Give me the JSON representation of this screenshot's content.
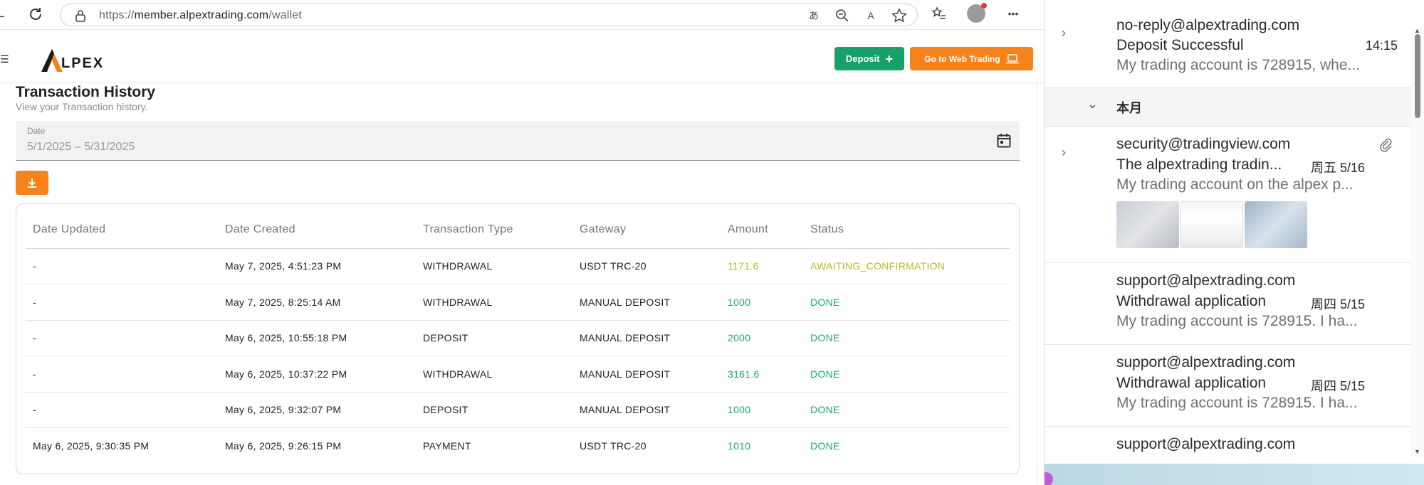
{
  "browser": {
    "url_prefix": "https://",
    "url_host": "member.alpextrading.com",
    "url_path": "/wallet"
  },
  "header": {
    "logo_text": "LPEX",
    "deposit_label": "Deposit",
    "web_trading_label": "Go to Web Trading",
    "accent_green": "#18a06a",
    "accent_orange": "#f7821b"
  },
  "main": {
    "title": "Transaction History",
    "subtitle": "View your Transaction history.",
    "date_label": "Date",
    "date_value": "5/1/2025 – 5/31/2025"
  },
  "table": {
    "columns": [
      "Date Updated",
      "Date Created",
      "Transaction Type",
      "Gateway",
      "Amount",
      "Status"
    ],
    "rows": [
      {
        "updated": "-",
        "created": "May 7, 2025, 4:51:23 PM",
        "type": "WITHDRAWAL",
        "gateway": "USDT TRC-20",
        "amount": "1171.6",
        "status": "AWAITING_CONFIRMATION"
      },
      {
        "updated": "-",
        "created": "May 7, 2025, 8:25:14 AM",
        "type": "WITHDRAWAL",
        "gateway": "MANUAL DEPOSIT",
        "amount": "1000",
        "status": "DONE"
      },
      {
        "updated": "-",
        "created": "May 6, 2025, 10:55:18 PM",
        "type": "DEPOSIT",
        "gateway": "MANUAL DEPOSIT",
        "amount": "2000",
        "status": "DONE"
      },
      {
        "updated": "-",
        "created": "May 6, 2025, 10:37:22 PM",
        "type": "WITHDRAWAL",
        "gateway": "MANUAL DEPOSIT",
        "amount": "3161.6",
        "status": "DONE"
      },
      {
        "updated": "-",
        "created": "May 6, 2025, 9:32:07 PM",
        "type": "DEPOSIT",
        "gateway": "MANUAL DEPOSIT",
        "amount": "1000",
        "status": "DONE"
      },
      {
        "updated": "May 6, 2025, 9:30:35 PM",
        "created": "May 6, 2025, 9:26:15 PM",
        "type": "PAYMENT",
        "gateway": "USDT TRC-20",
        "amount": "1010",
        "status": "DONE"
      }
    ]
  },
  "mail": {
    "month_header": "本月",
    "items": [
      {
        "from": "no-reply@alpextrading.com",
        "subject": "Deposit Successful",
        "time": "14:15",
        "preview": "My trading account is 728915, whe..."
      },
      {
        "from": "security@tradingview.com",
        "subject": "The alpextrading tradin...",
        "time": "周五 5/16",
        "preview": "My trading account on the alpex p..."
      },
      {
        "from": "support@alpextrading.com",
        "subject": "Withdrawal application",
        "time": "周四 5/15",
        "preview": "My trading account is 728915. I ha..."
      },
      {
        "from": "support@alpextrading.com",
        "subject": "Withdrawal application",
        "time": "周四 5/15",
        "preview": "My trading account is 728915. I ha..."
      },
      {
        "from": "support@alpextrading.com",
        "subject": "",
        "time": "",
        "preview": ""
      }
    ]
  }
}
